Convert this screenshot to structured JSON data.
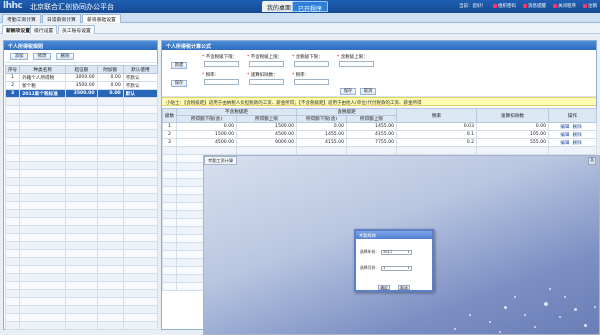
{
  "header": {
    "logo": "lhhc",
    "title": "北京联合汇创协同办公平台",
    "tabs": [
      "我的桌面",
      "已开程序"
    ],
    "user_info": "当前：您好！",
    "actions": [
      "组织密码",
      "消息提醒",
      "关闭程序",
      "注销"
    ]
  },
  "module_tabs": [
    "考勤工资计算",
    "日常薪资计算",
    "薪资基础设置"
  ],
  "sub_tabs": [
    "薪酬项设置",
    "级行设置",
    "员工账号设置"
  ],
  "left_panel": {
    "title": "个人所得税规则",
    "buttons": [
      "添加",
      "修改",
      "删除"
    ],
    "columns": [
      "序号",
      "种类名称",
      "起征额",
      "附加额",
      "默认使用"
    ],
    "rows": [
      [
        "1",
        "外籍个人所得税",
        "3000.00",
        "0.00",
        "不默认"
      ],
      [
        "2",
        "新个税",
        "3500.00",
        "0.00",
        "不默认"
      ],
      [
        "3",
        "2011新个税标准",
        "3500.00",
        "0.00",
        "默认"
      ]
    ]
  },
  "right_panel": {
    "title": "个人所得税计算公式",
    "add_button": "新建",
    "save_button": "保存",
    "form": {
      "row1": [
        "不含税级下限：",
        "不含税级上限：",
        "含税级下限：",
        "含税级上限："
      ],
      "row2": [
        "税率：",
        "速算扣除数：",
        "税率："
      ],
      "action_buttons": [
        "保存",
        "取消"
      ]
    },
    "notice": "小贴士：【含税级距】适用于由纳税人负担税款的工资、薪金所得；【不含税级距】适用于由他人(单位)代付税款的工资、薪金所得",
    "table": {
      "group_headers": [
        "级数",
        "不含税级距",
        "含税级距",
        "税率",
        "速算扣除数",
        "操作"
      ],
      "sub_headers": [
        "所得额下限(含)",
        "所得额上限",
        "所得额下限(含)",
        "所得额上限"
      ],
      "rows": [
        [
          "1",
          "0.00",
          "1500.00",
          "0.00",
          "1455.00",
          "0.03",
          "0.00"
        ],
        [
          "2",
          "1500.00",
          "4500.00",
          "1455.00",
          "4155.00",
          "0.1",
          "105.00"
        ],
        [
          "3",
          "4500.00",
          "9000.00",
          "4155.00",
          "7755.00",
          "0.2",
          "555.00"
        ]
      ],
      "row_actions": [
        "编辑",
        "删除"
      ]
    }
  },
  "overlay": {
    "tab_label": "考勤工资计算",
    "close": "X",
    "dialog": {
      "title": "考勤周期",
      "year_label": "选择年份：",
      "year_value": "2011",
      "month_label": "选择月份：",
      "month_value": "1",
      "ok": "确定",
      "cancel": "取消"
    }
  }
}
